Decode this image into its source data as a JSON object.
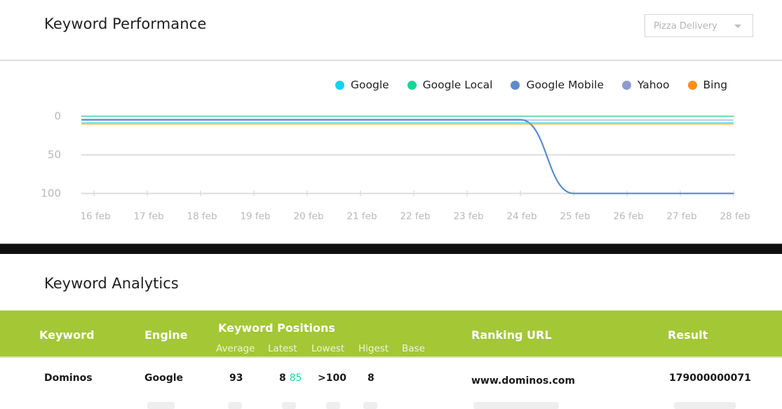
{
  "performance": {
    "title": "Keyword Performance",
    "dropdown": {
      "selected": "Pizza Delivery",
      "icon": "caret-down-icon"
    }
  },
  "chart_data": {
    "type": "line",
    "title": "",
    "xlabel": "",
    "ylabel": "",
    "x": [
      "16 feb",
      "17 feb",
      "18 feb",
      "19 feb",
      "20 feb",
      "21 feb",
      "22 feb",
      "23 feb",
      "24 feb",
      "25 feb",
      "26 feb",
      "27 feb",
      "28 feb"
    ],
    "yticks": [
      "0",
      "50",
      "100"
    ],
    "ylim": [
      0,
      100
    ],
    "y_inverted": true,
    "grid": true,
    "legend_position": "top-right",
    "series": [
      {
        "name": "Google",
        "color": "#13d3ee",
        "values": [
          8.5,
          8.5,
          8.5,
          8.5,
          8.5,
          8.5,
          8.5,
          8.5,
          8.5,
          8.5,
          8.5,
          8.5,
          8.5
        ]
      },
      {
        "name": "Google Local",
        "color": "#18d69a",
        "values": [
          0,
          0,
          0,
          0,
          0,
          0,
          0,
          0,
          0,
          0,
          0,
          0,
          0
        ]
      },
      {
        "name": "Google Mobile",
        "color": "#5b8cc9",
        "values": [
          4.5,
          4.5,
          4.5,
          4.5,
          4.5,
          4.5,
          4.5,
          4.5,
          4.5,
          100,
          100,
          100,
          100
        ]
      },
      {
        "name": "Yahoo",
        "color": "#8d9bcf",
        "values": [
          5,
          5,
          5,
          5,
          5,
          5,
          5,
          5,
          5,
          5,
          5,
          5,
          5
        ]
      },
      {
        "name": "Bing",
        "color": "#fb8f1c",
        "values": [
          10,
          10,
          10,
          10,
          10,
          10,
          10,
          10,
          10,
          10,
          10,
          10,
          10
        ]
      }
    ]
  },
  "analytics": {
    "title": "Keyword Analytics",
    "columns": {
      "keyword": "Keyword",
      "engine": "Engine",
      "positions": "Keyword Positions",
      "sub": [
        "Average",
        "Latest",
        "Lowest",
        "Higest",
        "Base"
      ],
      "url": "Ranking URL",
      "result": "Result"
    },
    "rows": [
      {
        "keyword": "Dominos",
        "engine": "Google",
        "average": "93",
        "latest": "8",
        "latest_change": "85",
        "lowest": ">100",
        "highest": "8",
        "base": "",
        "url": "www.dominos.com",
        "result": "179000000071"
      }
    ]
  }
}
